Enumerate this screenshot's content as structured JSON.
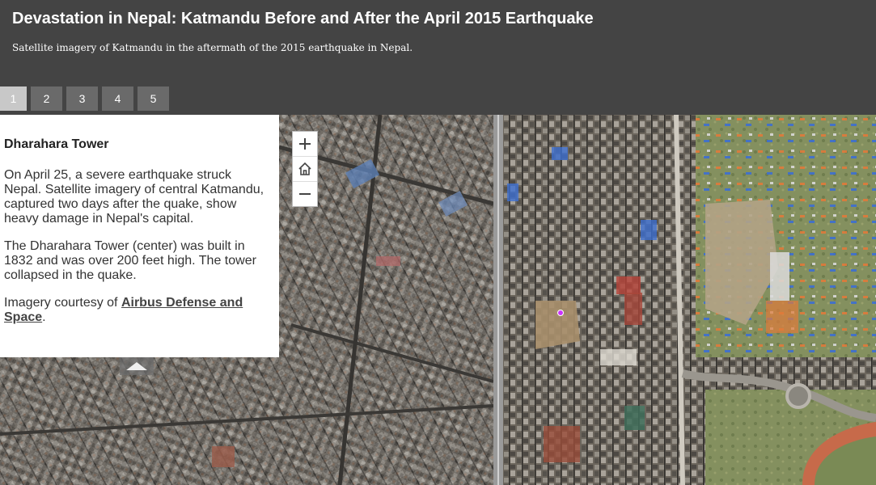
{
  "header": {
    "title": "Devastation in Nepal: Katmandu Before and After the April 2015 Earthquake",
    "subtitle": "Satellite imagery of Katmandu in the aftermath of the 2015 earthquake in Nepal."
  },
  "tabs": [
    {
      "label": "1",
      "active": true
    },
    {
      "label": "2",
      "active": false
    },
    {
      "label": "3",
      "active": false
    },
    {
      "label": "4",
      "active": false
    },
    {
      "label": "5",
      "active": false
    }
  ],
  "panel": {
    "heading": "Dharahara Tower",
    "p1": "On April 25, a severe earthquake struck Nepal. Satellite imagery of central Katmandu, captured two days after the quake, show heavy damage in Nepal's capital.",
    "p2": "The Dharahara Tower (center) was built in 1832 and was over 200 feet high. The tower collapsed in the quake.",
    "p3_prefix": "Imagery courtesy of ",
    "p3_link": "Airbus Defense and Space",
    "p3_suffix": "."
  },
  "zoom": {
    "in_icon": "plus-icon",
    "home_icon": "home-icon",
    "out_icon": "minus-icon"
  },
  "icons": {
    "collapse": "chevron-up-icon",
    "marker": "location-dot-icon"
  },
  "colors": {
    "header_bg": "#444444",
    "tab_bg": "#6a6a6a",
    "tab_active_bg": "#c8c8c8",
    "marker": "#cc33ff"
  }
}
